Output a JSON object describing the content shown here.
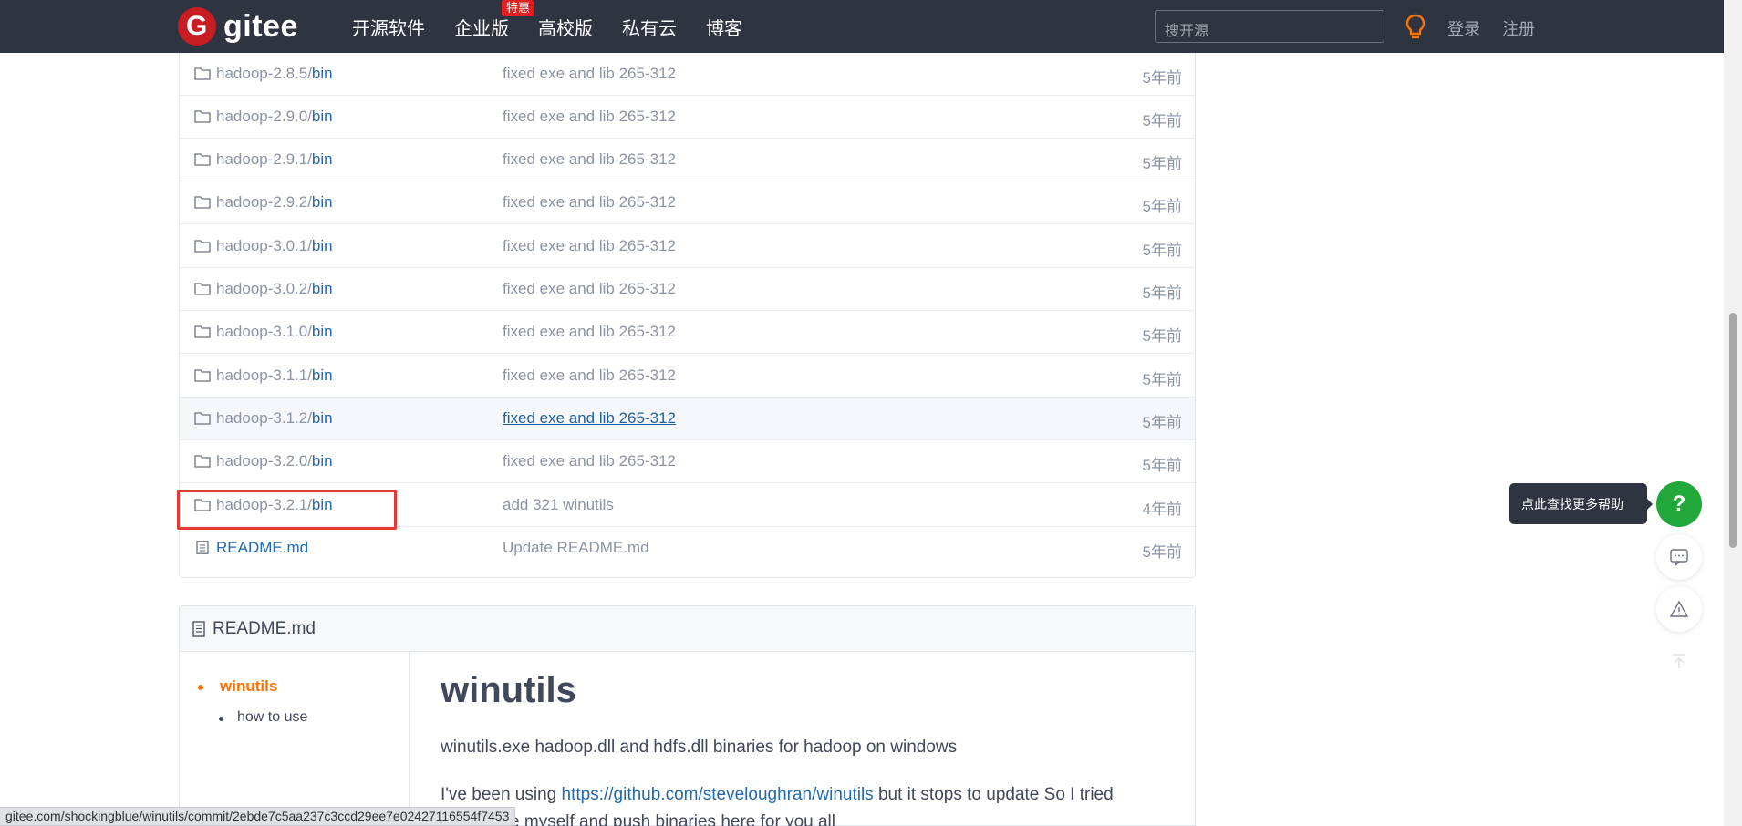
{
  "header": {
    "logo_text": "gitee",
    "nav": [
      "开源软件",
      "企业版",
      "高校版",
      "私有云",
      "博客"
    ],
    "badge": "特惠",
    "search_placeholder": "搜开源",
    "login": "登录",
    "register": "注册",
    "colors": {
      "bar": "#2f3441",
      "brand": "#c71d23",
      "bulb": "#fe7300"
    }
  },
  "files": [
    {
      "prefix": "hadoop-2.8.5/",
      "leaf": "bin",
      "message": "fixed exe and lib 265-312",
      "time": "5年前",
      "icon": "folder-icon"
    },
    {
      "prefix": "hadoop-2.9.0/",
      "leaf": "bin",
      "message": "fixed exe and lib 265-312",
      "time": "5年前",
      "icon": "folder-icon"
    },
    {
      "prefix": "hadoop-2.9.1/",
      "leaf": "bin",
      "message": "fixed exe and lib 265-312",
      "time": "5年前",
      "icon": "folder-icon"
    },
    {
      "prefix": "hadoop-2.9.2/",
      "leaf": "bin",
      "message": "fixed exe and lib 265-312",
      "time": "5年前",
      "icon": "folder-icon"
    },
    {
      "prefix": "hadoop-3.0.1/",
      "leaf": "bin",
      "message": "fixed exe and lib 265-312",
      "time": "5年前",
      "icon": "folder-icon"
    },
    {
      "prefix": "hadoop-3.0.2/",
      "leaf": "bin",
      "message": "fixed exe and lib 265-312",
      "time": "5年前",
      "icon": "folder-icon"
    },
    {
      "prefix": "hadoop-3.1.0/",
      "leaf": "bin",
      "message": "fixed exe and lib 265-312",
      "time": "5年前",
      "icon": "folder-icon"
    },
    {
      "prefix": "hadoop-3.1.1/",
      "leaf": "bin",
      "message": "fixed exe and lib 265-312",
      "time": "5年前",
      "icon": "folder-icon"
    },
    {
      "prefix": "hadoop-3.1.2/",
      "leaf": "bin",
      "message": "fixed exe and lib 265-312",
      "time": "5年前",
      "icon": "folder-icon"
    },
    {
      "prefix": "hadoop-3.2.0/",
      "leaf": "bin",
      "message": "fixed exe and lib 265-312",
      "time": "5年前",
      "icon": "folder-icon"
    },
    {
      "prefix": "hadoop-3.2.1/",
      "leaf": "bin",
      "message": "add 321 winutils",
      "time": "4年前",
      "icon": "folder-icon"
    },
    {
      "prefix": "",
      "leaf": "README.md",
      "message": "Update README.md",
      "time": "5年前",
      "icon": "file-icon"
    }
  ],
  "readme": {
    "title": "README.md",
    "toc": [
      "winutils",
      "how to use"
    ],
    "h1": "winutils",
    "p1": "winutils.exe hadoop.dll and hdfs.dll binaries for hadoop on windows",
    "p2_before": "I've been using ",
    "p2_link": "https://github.com/steveloughran/winutils",
    "p2_after": " but it stops to update So I tried",
    "p3": "to compile myself and push binaries here for you all"
  },
  "help": {
    "tooltip": "点此查找更多帮助",
    "button": "?"
  },
  "status_url": "gitee.com/shockingblue/winutils/commit/2ebde7c5aa237c3ccd29ee7e02427116554f7453"
}
